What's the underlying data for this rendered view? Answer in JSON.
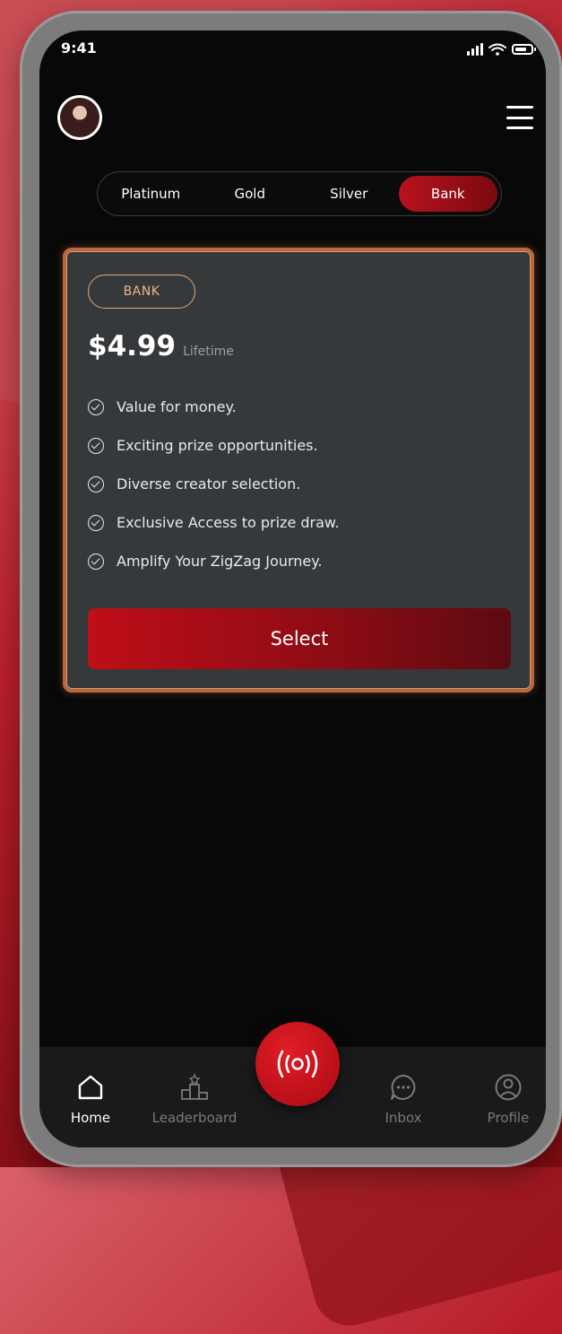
{
  "status_bar": {
    "time": "9:41",
    "icons": [
      "signal-icon",
      "wifi-icon",
      "battery-icon"
    ]
  },
  "header": {
    "avatar": "profile-avatar",
    "menu_icon": "hamburger-menu-icon"
  },
  "tabs": [
    {
      "label": "Platinum",
      "active": false
    },
    {
      "label": "Gold",
      "active": false
    },
    {
      "label": "Silver",
      "active": false
    },
    {
      "label": "Bank",
      "active": true
    }
  ],
  "plan": {
    "badge": "BANK",
    "price": "$4.99",
    "period": "Lifetime",
    "features": [
      "Value for money.",
      "Exciting prize opportunities.",
      "Diverse creator selection.",
      "Exclusive Access to prize draw.",
      "Amplify Your ZigZag Journey."
    ],
    "select_label": "Select"
  },
  "bottom_nav": {
    "home": "Home",
    "leaderboard": "Leaderboard",
    "center_icon": "broadcast-icon",
    "inbox": "Inbox",
    "profile": "Profile"
  },
  "colors": {
    "accent": "#b8121c",
    "card_border": "#b7673b",
    "badge": "#f0b385",
    "screen_bg": "#080808",
    "card_bg": "#36393c"
  }
}
